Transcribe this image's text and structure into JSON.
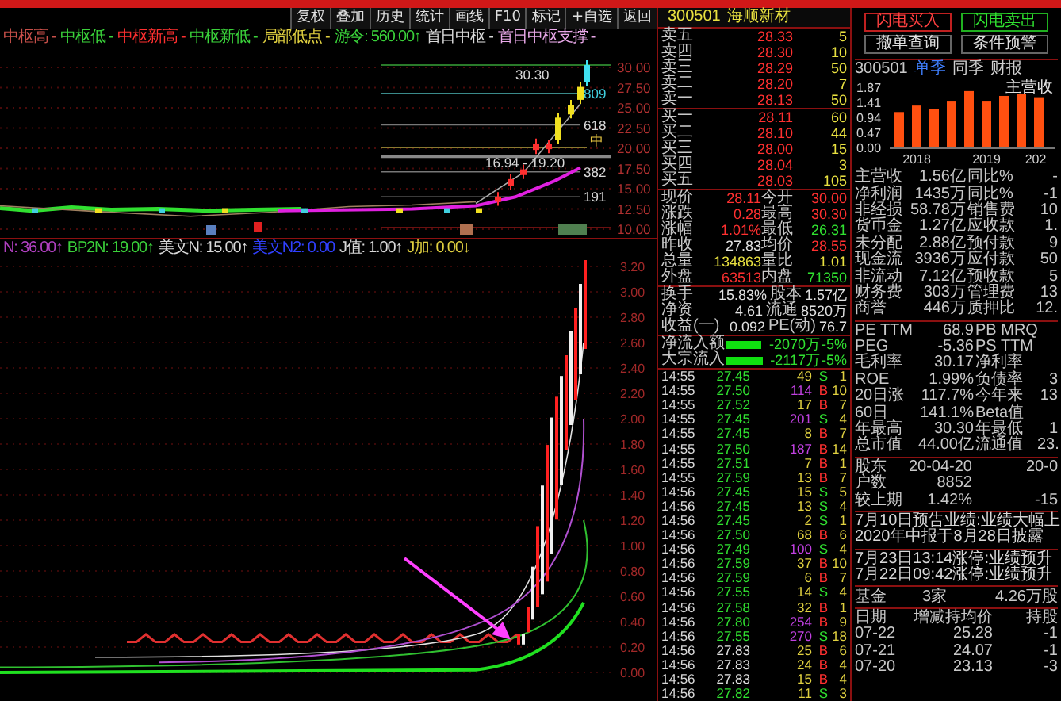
{
  "toolbar": [
    "复权",
    "叠加",
    "历史",
    "统计",
    "画线",
    "F10",
    "标记",
    "+自选",
    "返回"
  ],
  "chart_legend": [
    {
      "label": "中枢高 -",
      "color": "#c8504a"
    },
    {
      "label": "中枢低 -",
      "color": "#3ad13a"
    },
    {
      "label": "中枢新高 -",
      "color": "#ff3030"
    },
    {
      "label": "中枢新低 -",
      "color": "#3ad13a"
    },
    {
      "label": "局部低点 -",
      "color": "#e0d040"
    },
    {
      "label": "游令: 560.00↑",
      "color": "#3ad13a"
    },
    {
      "label": "首日中枢 -",
      "color": "#d8d8d8"
    },
    {
      "label": "首日中枢支撑 -",
      "color": "#e8a8e8"
    }
  ],
  "price_chart": {
    "axis_labels": [
      "30.00",
      "27.50",
      "25.00",
      "22.50",
      "20.00",
      "17.50",
      "15.00",
      "12.50",
      "10.00"
    ],
    "annotations": [
      {
        "text": "30.30",
        "kind": "high"
      },
      {
        "text": "809",
        "kind": "level"
      },
      {
        "text": "618",
        "kind": "level"
      },
      {
        "text": "中",
        "kind": "mid"
      },
      {
        "text": "16.94 - 19.20",
        "kind": "range"
      },
      {
        "text": "382",
        "kind": "level"
      },
      {
        "text": "191",
        "kind": "level"
      }
    ]
  },
  "indicator_legend": [
    {
      "label": "N: 36.00↑",
      "color": "#b040c0"
    },
    {
      "label": "BP2N: 19.00↑",
      "color": "#3ad13a"
    },
    {
      "label": "美文N: 15.00↑",
      "color": "#d8d8d8"
    },
    {
      "label": "美文N2: 0.00",
      "color": "#3040ff"
    },
    {
      "label": "J值: 1.00↑",
      "color": "#d8d8d8"
    },
    {
      "label": "J加: 0.00↓",
      "color": "#e0d040"
    }
  ],
  "indicator_chart": {
    "axis_labels": [
      "3.20",
      "3.00",
      "2.80",
      "2.60",
      "2.40",
      "2.20",
      "2.00",
      "1.80",
      "1.60",
      "1.40",
      "1.20",
      "1.00",
      "0.80",
      "0.60",
      "0.40",
      "0.20",
      "0.00"
    ]
  },
  "quote": {
    "code": "300501",
    "name": "海顺新材"
  },
  "asks": [
    {
      "label": "卖五",
      "price": "28.33",
      "volume": "5"
    },
    {
      "label": "卖四",
      "price": "28.30",
      "volume": "10"
    },
    {
      "label": "卖三",
      "price": "28.29",
      "volume": "50"
    },
    {
      "label": "卖二",
      "price": "28.20",
      "volume": "7"
    },
    {
      "label": "卖一",
      "price": "28.13",
      "volume": "50"
    }
  ],
  "bids": [
    {
      "label": "买一",
      "price": "28.11",
      "volume": "60"
    },
    {
      "label": "买二",
      "price": "28.10",
      "volume": "44"
    },
    {
      "label": "买三",
      "price": "28.00",
      "volume": "15"
    },
    {
      "label": "买四",
      "price": "28.04",
      "volume": "3"
    },
    {
      "label": "买五",
      "price": "28.03",
      "volume": "105"
    }
  ],
  "quote_rows": [
    [
      {
        "label": "现价",
        "value": "28.11",
        "color": "#ff3030"
      },
      {
        "label": "今开",
        "value": "30.00",
        "color": "#ff3030"
      }
    ],
    [
      {
        "label": "涨跌",
        "value": "0.28",
        "color": "#ff3030"
      },
      {
        "label": "最高",
        "value": "30.30",
        "color": "#ff3030"
      }
    ],
    [
      {
        "label": "涨幅",
        "value": "1.01%",
        "color": "#ff3030"
      },
      {
        "label": "最低",
        "value": "26.31",
        "color": "#30e030"
      }
    ],
    [
      {
        "label": "昨收",
        "value": "27.83",
        "color": "#e0e0e0"
      },
      {
        "label": "均价",
        "value": "28.55",
        "color": "#ff3030"
      }
    ],
    [
      {
        "label": "总量",
        "value": "134863",
        "color": "#e8e040"
      },
      {
        "label": "量比",
        "value": "1.01",
        "color": "#e8e040"
      }
    ],
    [
      {
        "label": "外盘",
        "value": "63513",
        "color": "#ff3030"
      },
      {
        "label": "内盘",
        "value": "71350",
        "color": "#30e030"
      }
    ]
  ],
  "share_rows": [
    [
      {
        "label": "换手",
        "value": "15.83%"
      },
      {
        "label": "股本",
        "value": "1.57亿"
      }
    ],
    [
      {
        "label": "净资",
        "value": "4.61"
      },
      {
        "label": "流通",
        "value": "8520万"
      }
    ],
    [
      {
        "label": "收益(一)",
        "value": "0.092"
      },
      {
        "label": "PE(动)",
        "value": "76.7"
      }
    ]
  ],
  "flows": [
    {
      "label": "净流入额",
      "level": 0.85,
      "amount": "-2070万",
      "share": "-5%"
    },
    {
      "label": "大宗流入",
      "level": 0.87,
      "amount": "-2117万",
      "share": "-5%"
    }
  ],
  "ticks": [
    {
      "time": "14:55",
      "price": {
        "text": "27.45",
        "color": "#30e030"
      },
      "volume": {
        "text": "49",
        "color": "#e0d040"
      },
      "side": {
        "text": "S",
        "color": "#30e030"
      },
      "count": "1"
    },
    {
      "time": "14:55",
      "price": {
        "text": "27.50",
        "color": "#30e030"
      },
      "volume": {
        "text": "114",
        "color": "#c040e0"
      },
      "side": {
        "text": "B",
        "color": "#ff3030"
      },
      "count": "10"
    },
    {
      "time": "14:55",
      "price": {
        "text": "27.52",
        "color": "#30e030"
      },
      "volume": {
        "text": "17",
        "color": "#e0d040"
      },
      "side": {
        "text": "B",
        "color": "#ff3030"
      },
      "count": "7"
    },
    {
      "time": "14:55",
      "price": {
        "text": "27.45",
        "color": "#30e030"
      },
      "volume": {
        "text": "201",
        "color": "#c040e0"
      },
      "side": {
        "text": "S",
        "color": "#30e030"
      },
      "count": "4"
    },
    {
      "time": "14:55",
      "price": {
        "text": "27.45",
        "color": "#30e030"
      },
      "volume": {
        "text": "8",
        "color": "#e0d040"
      },
      "side": {
        "text": "B",
        "color": "#ff3030"
      },
      "count": "7"
    },
    {
      "time": "14:55",
      "price": {
        "text": "27.50",
        "color": "#30e030"
      },
      "volume": {
        "text": "187",
        "color": "#c040e0"
      },
      "side": {
        "text": "B",
        "color": "#ff3030"
      },
      "count": "14"
    },
    {
      "time": "14:55",
      "price": {
        "text": "27.51",
        "color": "#30e030"
      },
      "volume": {
        "text": "7",
        "color": "#e0d040"
      },
      "side": {
        "text": "B",
        "color": "#ff3030"
      },
      "count": "1"
    },
    {
      "time": "14:55",
      "price": {
        "text": "27.59",
        "color": "#30e030"
      },
      "volume": {
        "text": "13",
        "color": "#e0d040"
      },
      "side": {
        "text": "B",
        "color": "#ff3030"
      },
      "count": "7"
    },
    {
      "time": "14:56",
      "price": {
        "text": "27.45",
        "color": "#30e030"
      },
      "volume": {
        "text": "15",
        "color": "#e0d040"
      },
      "side": {
        "text": "S",
        "color": "#30e030"
      },
      "count": "5"
    },
    {
      "time": "14:56",
      "price": {
        "text": "27.45",
        "color": "#30e030"
      },
      "volume": {
        "text": "13",
        "color": "#e0d040"
      },
      "side": {
        "text": "S",
        "color": "#30e030"
      },
      "count": "4"
    },
    {
      "time": "14:56",
      "price": {
        "text": "27.45",
        "color": "#30e030"
      },
      "volume": {
        "text": "2",
        "color": "#e0d040"
      },
      "side": {
        "text": "S",
        "color": "#30e030"
      },
      "count": "1"
    },
    {
      "time": "14:56",
      "price": {
        "text": "27.50",
        "color": "#30e030"
      },
      "volume": {
        "text": "68",
        "color": "#e0d040"
      },
      "side": {
        "text": "B",
        "color": "#ff3030"
      },
      "count": "6"
    },
    {
      "time": "14:56",
      "price": {
        "text": "27.49",
        "color": "#30e030"
      },
      "volume": {
        "text": "100",
        "color": "#c040e0"
      },
      "side": {
        "text": "S",
        "color": "#30e030"
      },
      "count": "4"
    },
    {
      "time": "14:56",
      "price": {
        "text": "27.59",
        "color": "#30e030"
      },
      "volume": {
        "text": "37",
        "color": "#e0d040"
      },
      "side": {
        "text": "B",
        "color": "#ff3030"
      },
      "count": "10"
    },
    {
      "time": "14:56",
      "price": {
        "text": "27.59",
        "color": "#30e030"
      },
      "volume": {
        "text": "6",
        "color": "#e0d040"
      },
      "side": {
        "text": "B",
        "color": "#ff3030"
      },
      "count": "7"
    },
    {
      "time": "14:56",
      "price": {
        "text": "27.55",
        "color": "#30e030"
      },
      "volume": {
        "text": "14",
        "color": "#e0d040"
      },
      "side": {
        "text": "S",
        "color": "#30e030"
      },
      "count": "4"
    },
    {
      "time": "14:56",
      "price": {
        "text": "27.58",
        "color": "#30e030"
      },
      "volume": {
        "text": "32",
        "color": "#e0d040"
      },
      "side": {
        "text": "B",
        "color": "#ff3030"
      },
      "count": "1"
    },
    {
      "time": "14:56",
      "price": {
        "text": "27.80",
        "color": "#30e030"
      },
      "volume": {
        "text": "254",
        "color": "#c040e0"
      },
      "side": {
        "text": "B",
        "color": "#ff3030"
      },
      "count": "9"
    },
    {
      "time": "14:56",
      "price": {
        "text": "27.55",
        "color": "#30e030"
      },
      "volume": {
        "text": "270",
        "color": "#c040e0"
      },
      "side": {
        "text": "S",
        "color": "#30e030"
      },
      "count": "18"
    },
    {
      "time": "14:56",
      "price": {
        "text": "27.83",
        "color": "#e0e0e0"
      },
      "volume": {
        "text": "25",
        "color": "#e0d040"
      },
      "side": {
        "text": "B",
        "color": "#ff3030"
      },
      "count": "6"
    },
    {
      "time": "14:56",
      "price": {
        "text": "27.83",
        "color": "#e0e0e0"
      },
      "volume": {
        "text": "24",
        "color": "#e0d040"
      },
      "side": {
        "text": "B",
        "color": "#ff3030"
      },
      "count": "4"
    },
    {
      "time": "14:56",
      "price": {
        "text": "27.83",
        "color": "#e0e0e0"
      },
      "volume": {
        "text": "15",
        "color": "#e0d040"
      },
      "side": {
        "text": "B",
        "color": "#ff3030"
      },
      "count": "4"
    },
    {
      "time": "14:56",
      "price": {
        "text": "27.82",
        "color": "#30e030"
      },
      "volume": {
        "text": "11",
        "color": "#e0d040"
      },
      "side": {
        "text": "S",
        "color": "#30e030"
      },
      "count": "3"
    }
  ],
  "actions": [
    {
      "label": "闪电买入",
      "kind": "buy"
    },
    {
      "label": "闪电卖出",
      "kind": "sell"
    },
    {
      "label": "撤单查询",
      "kind": "plain"
    },
    {
      "label": "条件预警",
      "kind": "plain"
    }
  ],
  "finance_header": {
    "code": "300501",
    "tabs": [
      {
        "label": "单季",
        "selected": true
      },
      {
        "label": "同季",
        "selected": false
      },
      {
        "label": "财报",
        "selected": false
      }
    ]
  },
  "revenue_chart": {
    "chart_data": {
      "type": "bar",
      "title": "主营收",
      "categories": [
        null,
        "2018",
        null,
        null,
        null,
        "2019",
        null,
        null,
        "202"
      ],
      "values": [
        1.1,
        1.3,
        1.2,
        1.45,
        1.75,
        1.45,
        1.6,
        1.65,
        1.56
      ],
      "ylim": [
        0,
        1.87
      ],
      "yticks": [
        {
          "value": 0,
          "label": "0.00"
        },
        {
          "value": 0.47,
          "label": "0.47"
        },
        {
          "value": 0.94,
          "label": "0.94"
        },
        {
          "value": 1.41,
          "label": "1.41"
        },
        {
          "value": 1.87,
          "label": "1.87"
        }
      ]
    }
  },
  "finance_rows": [
    [
      "主营收",
      "1.56亿",
      "同比%",
      "-"
    ],
    [
      "净利润",
      "1435万",
      "同比%",
      "-1"
    ],
    [
      "非经损",
      "58.78万",
      "销售费",
      "10"
    ],
    [
      "货币金",
      "1.27亿",
      "应收款",
      "1."
    ],
    [
      "未分配",
      "2.88亿",
      "预付款",
      "9"
    ],
    [
      "现金流",
      "3936万",
      "应付款",
      "50"
    ],
    [
      "非流动",
      "7.12亿",
      "预收款",
      "5"
    ],
    [
      "财务费",
      "303万",
      "管理费",
      "13"
    ],
    [
      "商誉",
      "446万",
      "质押比",
      "12."
    ]
  ],
  "valuation_rows": [
    [
      "PE TTM",
      "68.9",
      "PB MRQ"
    ],
    [
      "PEG",
      "-5.36",
      "PS TTM"
    ],
    [
      "毛利率",
      "30.17",
      "净利率"
    ],
    [
      "ROE",
      "1.99%",
      "负债率",
      "3"
    ],
    [
      "20日涨",
      "117.7%",
      "今年来",
      "13"
    ],
    [
      "60日",
      "141.1%",
      "Beta值"
    ],
    [
      "年最高",
      "30.30",
      "年最低",
      "1"
    ],
    [
      "总市值",
      "44.00亿",
      "流通值",
      "23."
    ]
  ],
  "holder_rows": [
    [
      "股东",
      "20-04-20",
      "20-0"
    ],
    [
      "户数",
      "8852"
    ],
    [
      "较上期",
      "1.42%",
      "-15"
    ]
  ],
  "notices": [
    "7月10日预告业绩:业绩大幅上",
    "2020年中报于8月28日披露"
  ],
  "limit_notices": [
    "7月23日13:14涨停:业绩预升",
    "7月22日09:42涨停:业绩预升"
  ],
  "fund_row": [
    "基金",
    "3家",
    "4.26万股"
  ],
  "holdings_table": {
    "columns": [
      "日期",
      "增减持均价",
      "持股"
    ],
    "rows": [
      [
        "07-22",
        "25.28",
        "-1"
      ],
      [
        "07-21",
        "24.07",
        "-1"
      ],
      [
        "07-20",
        "23.13",
        "-3"
      ]
    ]
  }
}
